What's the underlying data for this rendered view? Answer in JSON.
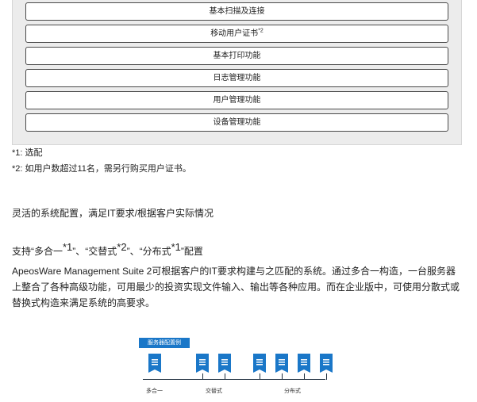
{
  "features": [
    {
      "label": "基本扫描及连接",
      "sup": ""
    },
    {
      "label": "移动用户证书",
      "sup": "*2"
    },
    {
      "label": "基本打印功能",
      "sup": ""
    },
    {
      "label": "日志管理功能",
      "sup": ""
    },
    {
      "label": "用户管理功能",
      "sup": ""
    },
    {
      "label": "设备管理功能",
      "sup": ""
    }
  ],
  "notes": {
    "n1": "*1: 选配",
    "n2": "*2: 如用户数超过11名，需另行购买用户证书。"
  },
  "section": {
    "title": "灵活的系统配置，满足IT要求/根据客户实际情况",
    "subtitle": {
      "p1": "支持“多合一",
      "s1": "*1",
      "p2": "”、“交替式",
      "s2": "*2",
      "p3": "”、“分布式",
      "s3": "*1",
      "p4": "”配置"
    },
    "paragraph": "ApeosWare Management Suite 2可根据客户的IT要求构建与之匹配的系统。通过多合一构造，一台服务器上整合了各种高级功能，可用最少的投资实现文件输入、输出等各种应用。而在企业版中，可使用分散式或替换式构造来满足系统的高要求。"
  },
  "diagram": {
    "title": "服务器配置例",
    "captions": {
      "all_in_one": "多合一",
      "alternate": "交替式",
      "distributed": "分布式"
    },
    "colors": {
      "server": "#1a77c8",
      "line": "#1f2f3f"
    }
  }
}
